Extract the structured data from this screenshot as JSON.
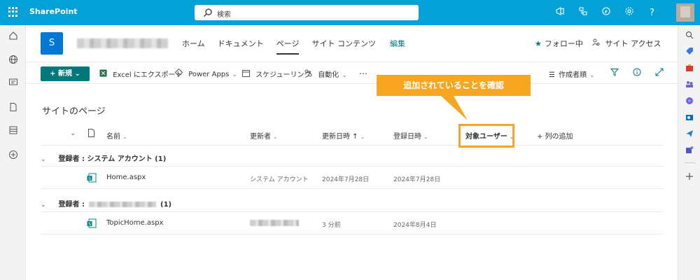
{
  "suite": {
    "brand": "SharePoint",
    "search_placeholder": "検索",
    "icons": [
      "megaphone-icon",
      "flow-icon",
      "help-sparkle-icon",
      "gear-icon",
      "question-icon"
    ],
    "question_glyph": "?"
  },
  "site": {
    "logo_letter": "S",
    "nav": [
      {
        "label": "ホーム"
      },
      {
        "label": "ドキュメント"
      },
      {
        "label": "ページ",
        "active": true
      },
      {
        "label": "サイト コンテンツ"
      },
      {
        "label": "編集"
      }
    ],
    "follow_label": "フォロー中",
    "access_label": "サイト アクセス"
  },
  "commands": {
    "new_label": "新規",
    "export_label": "Excel にエクスポート",
    "powerapps_label": "Power Apps",
    "schedule_label": "スケジューリング",
    "automate_label": "自動化",
    "more_label": "…",
    "sort_label": "作成者順"
  },
  "callout": {
    "text": "追加されていることを確認",
    "color": "#f6a623"
  },
  "list": {
    "title": "サイトのページ",
    "columns": {
      "name": "名前",
      "modified_by": "更新者",
      "modified": "更新日時 ↑",
      "created": "登録日時",
      "audience": "対象ユーザー",
      "add_column": "+ 列の追加"
    },
    "groups": [
      {
        "label": "登録者 : システム アカウント (1)",
        "rows": [
          {
            "name": "Home.aspx",
            "modified_by": "システム アカウント",
            "modified": "2024年7月28日",
            "created": "2024年7月28日"
          }
        ]
      },
      {
        "label_prefix": "登録者 :",
        "label_suffix": "(1)",
        "rows": [
          {
            "name": "TopicHome.aspx",
            "modified": "3 分前",
            "created": "2024年8月4日"
          }
        ]
      }
    ]
  },
  "colors": {
    "suite_bar": "#03a1d8",
    "accent": "#03787c",
    "site_logo": "#0078d4"
  }
}
